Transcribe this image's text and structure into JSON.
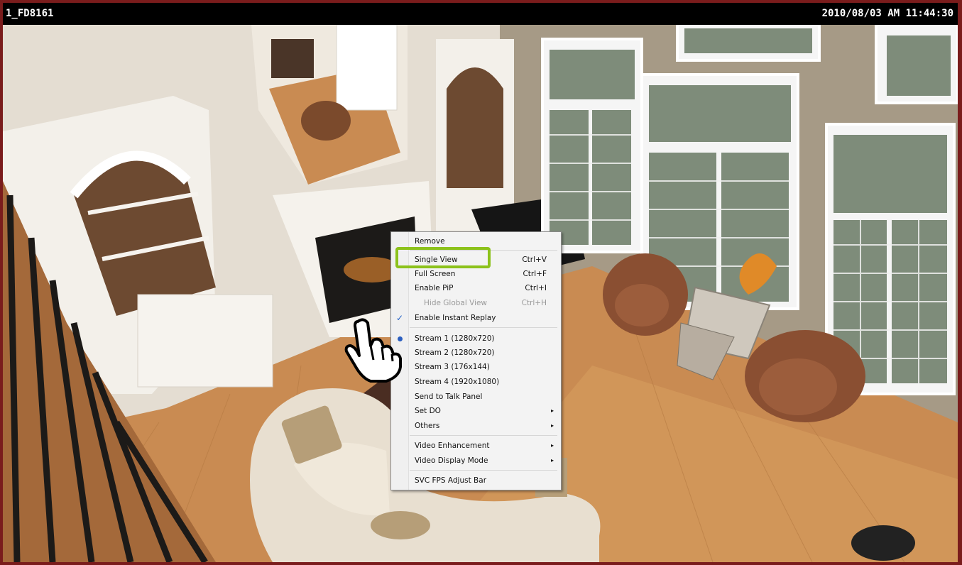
{
  "camera": {
    "name": "1_FD8161",
    "timestamp": "2010/08/03 AM 11:44:30"
  },
  "context_menu": {
    "items": [
      {
        "label": "Remove",
        "shortcut": "",
        "state": "normal"
      },
      {
        "label": "Single View",
        "shortcut": "Ctrl+V",
        "state": "highlighted"
      },
      {
        "label": "Full Screen",
        "shortcut": "Ctrl+F",
        "state": "normal"
      },
      {
        "label": "Enable PiP",
        "shortcut": "Ctrl+I",
        "state": "normal"
      },
      {
        "label": "Hide Global View",
        "shortcut": "Ctrl+H",
        "state": "disabled"
      },
      {
        "label": "Enable Instant Replay",
        "shortcut": "",
        "state": "checked"
      },
      {
        "label": "Stream 1 (1280x720)",
        "shortcut": "",
        "state": "selected"
      },
      {
        "label": "Stream 2 (1280x720)",
        "shortcut": "",
        "state": "normal"
      },
      {
        "label": "Stream 3 (176x144)",
        "shortcut": "",
        "state": "normal"
      },
      {
        "label": "Stream 4 (1920x1080)",
        "shortcut": "",
        "state": "normal"
      },
      {
        "label": "Send to Talk Panel",
        "shortcut": "",
        "state": "normal"
      },
      {
        "label": "Set DO",
        "shortcut": "",
        "state": "submenu"
      },
      {
        "label": "Others",
        "shortcut": "",
        "state": "submenu"
      },
      {
        "label": "Video Enhancement",
        "shortcut": "",
        "state": "submenu"
      },
      {
        "label": "Video Display Mode",
        "shortcut": "",
        "state": "submenu"
      },
      {
        "label": "SVC FPS Adjust Bar",
        "shortcut": "",
        "state": "normal"
      }
    ]
  },
  "colors": {
    "window_border": "#7a1c1c",
    "highlight_ring": "#8cc21b",
    "check_blue": "#1f5fc7"
  },
  "icons": [
    "check-icon",
    "radio-dot-icon",
    "submenu-arrow-icon",
    "hand-pointer-icon"
  ]
}
